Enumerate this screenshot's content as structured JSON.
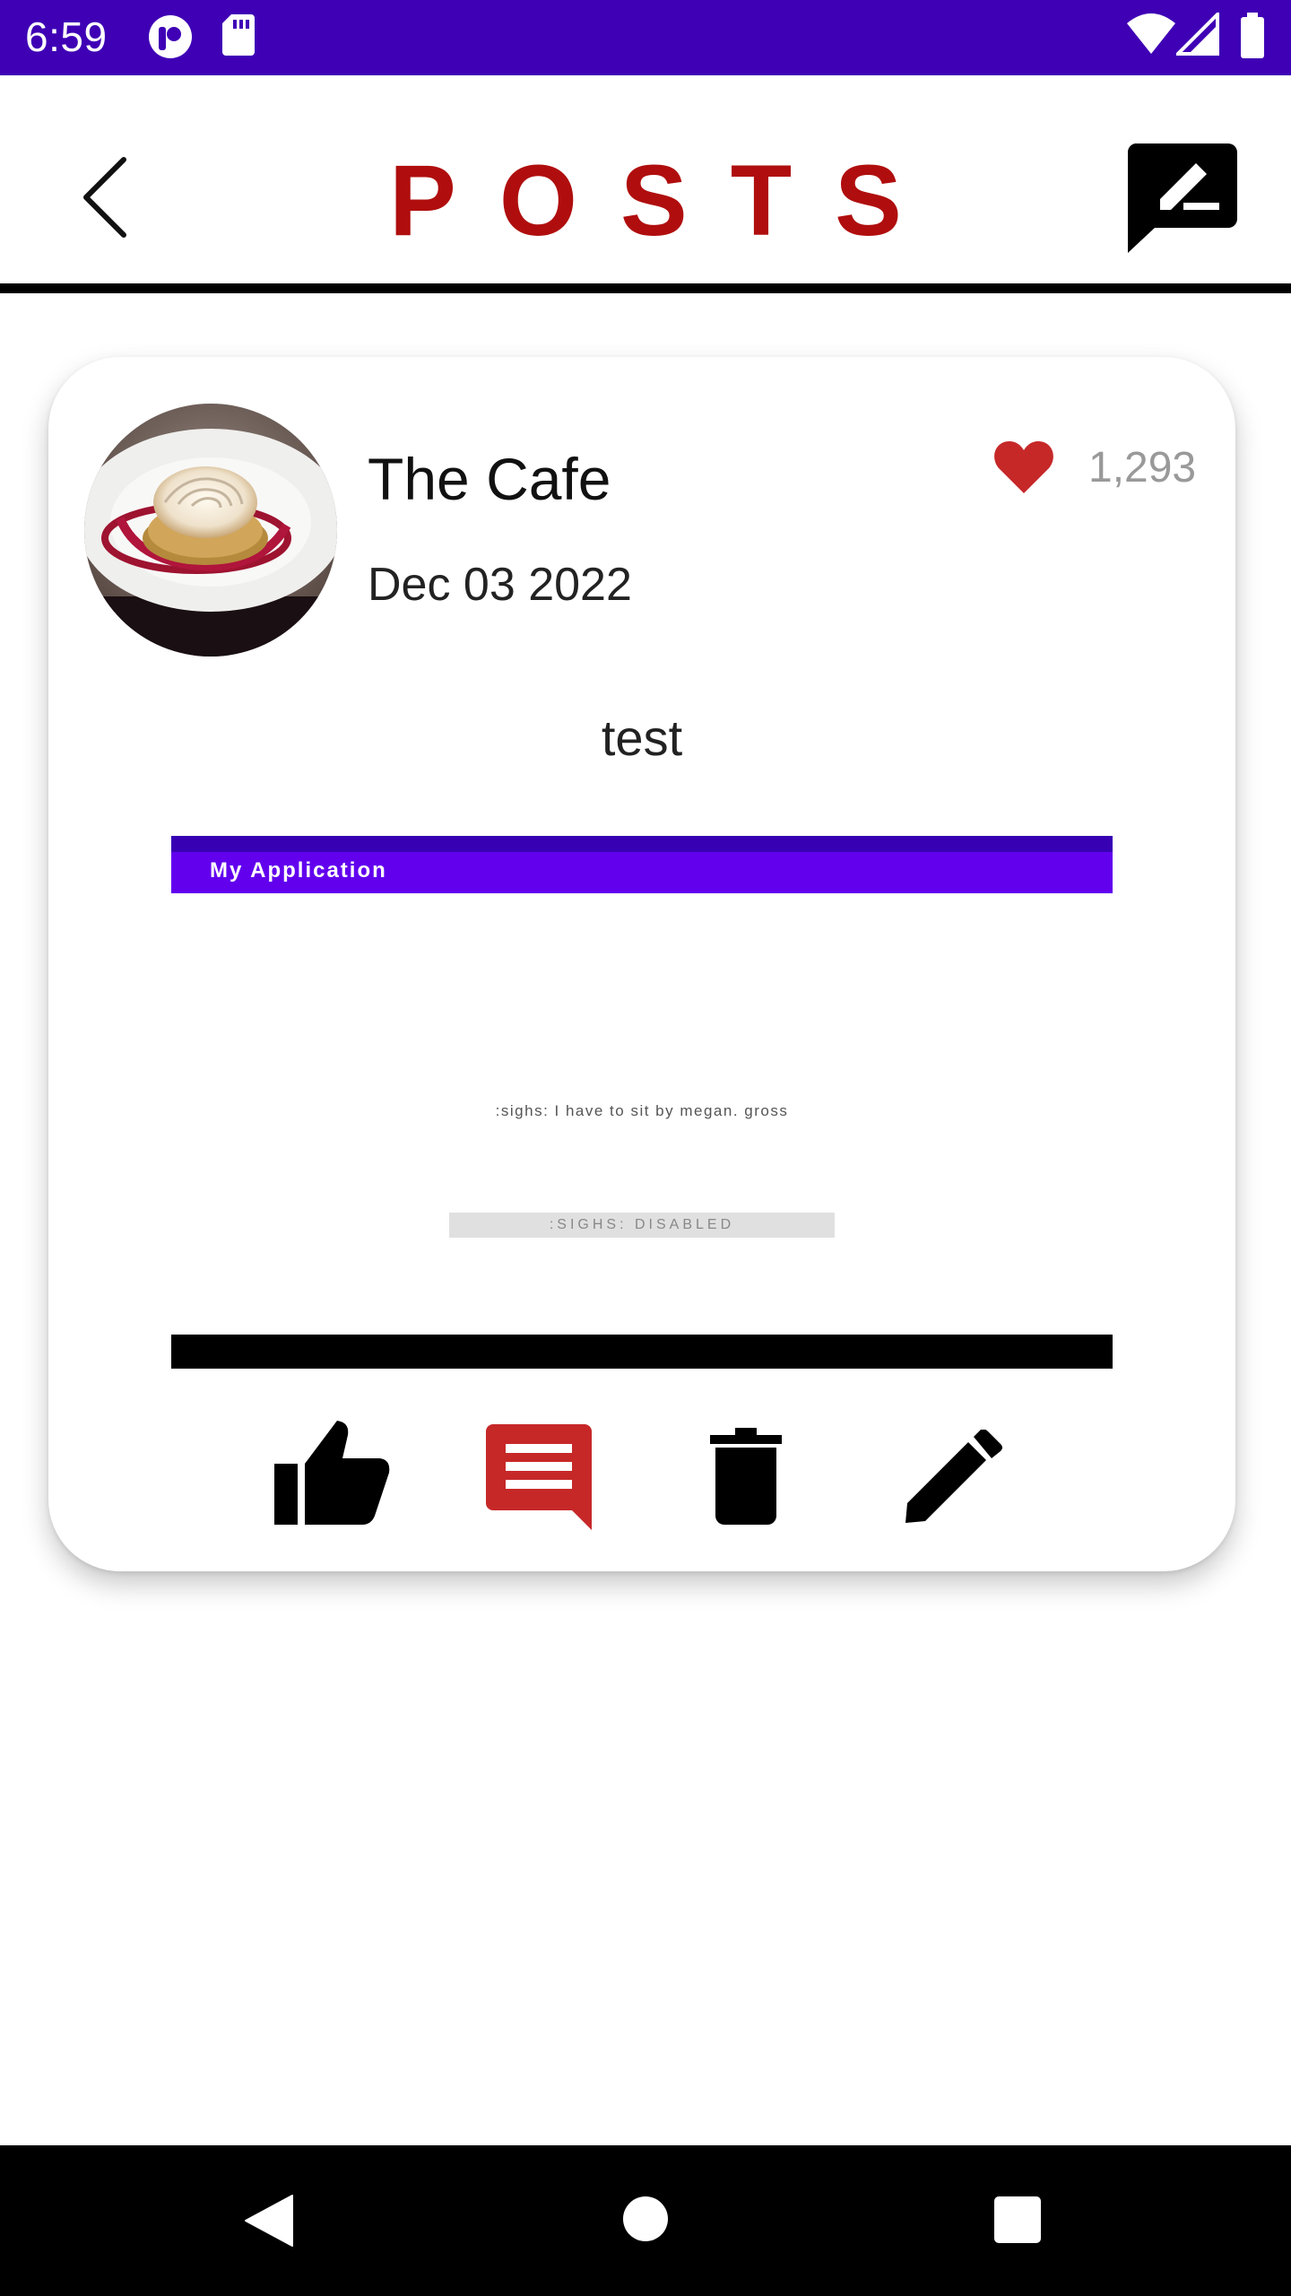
{
  "status_bar": {
    "time": "6:59",
    "background": "#3f00b5",
    "icons": [
      "app-notification-icon",
      "sd-card-icon",
      "wifi-icon",
      "cellular-signal-icon",
      "battery-icon"
    ]
  },
  "header": {
    "title": "POSTS",
    "title_color": "#b00e0e",
    "back_icon": "chevron-left-icon",
    "compose_icon": "rate-review-icon"
  },
  "post": {
    "author": "The Cafe",
    "date": "Dec 03 2022",
    "likes": "1,293",
    "heart_color": "#c62828",
    "text": "test",
    "image": {
      "app_title": "My Application",
      "message": ":sighs: I have to sit by megan. gross",
      "button_label": ":SIGHS: DISABLED"
    },
    "actions": [
      {
        "name": "like",
        "icon": "thumb-up-icon"
      },
      {
        "name": "comment",
        "icon": "comment-icon",
        "color": "#c62828"
      },
      {
        "name": "delete",
        "icon": "trash-icon"
      },
      {
        "name": "edit",
        "icon": "pencil-icon"
      }
    ]
  },
  "nav_bar": {
    "icons": [
      "back-triangle-icon",
      "home-circle-icon",
      "recents-square-icon"
    ]
  }
}
